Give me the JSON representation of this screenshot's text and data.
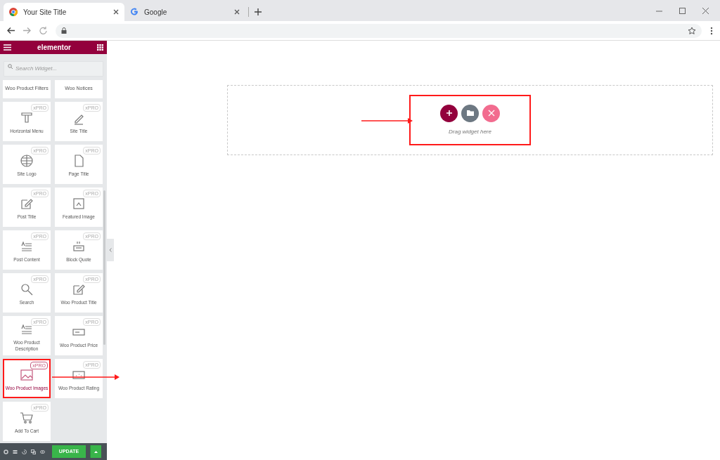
{
  "browser": {
    "tabs": [
      {
        "title": "Your Site Title",
        "selected": true
      },
      {
        "title": "Google",
        "selected": false
      }
    ]
  },
  "editor": {
    "brand": "elementor",
    "search": {
      "placeholder": "Search Widget..."
    },
    "widgets": [
      {
        "kind": "compact",
        "label": "Woo Product Filters",
        "selected": false
      },
      {
        "kind": "compact",
        "label": "Woo Notices",
        "selected": false
      },
      {
        "kind": "tile",
        "label": "Horizontal Menu",
        "badge": "xPRO",
        "selected": false
      },
      {
        "kind": "tile",
        "label": "Site Title",
        "badge": "xPRO",
        "selected": false
      },
      {
        "kind": "tile",
        "label": "Site Logo",
        "badge": "xPRO",
        "selected": false
      },
      {
        "kind": "tile",
        "label": "Page Title",
        "badge": "xPRO",
        "selected": false
      },
      {
        "kind": "tile",
        "label": "Post Title",
        "badge": "xPRO",
        "selected": false
      },
      {
        "kind": "tile",
        "label": "Featured Image",
        "badge": "xPRO",
        "selected": false
      },
      {
        "kind": "tile",
        "label": "Post Content",
        "badge": "xPRO",
        "selected": false
      },
      {
        "kind": "tile",
        "label": "Block Quote",
        "badge": "xPRO",
        "selected": false
      },
      {
        "kind": "tile",
        "label": "Search",
        "badge": "xPRO",
        "selected": false
      },
      {
        "kind": "tile",
        "label": "Woo Product Title",
        "badge": "xPRO",
        "selected": false
      },
      {
        "kind": "tile",
        "label": "Woo Product Description",
        "badge": "xPRO",
        "selected": false
      },
      {
        "kind": "tile",
        "label": "Woo Product Price",
        "badge": "xPRO",
        "selected": false
      },
      {
        "kind": "tile",
        "label": "Woo Product Images",
        "badge": "xPRO",
        "selected": true
      },
      {
        "kind": "tile",
        "label": "Woo Product Rating",
        "badge": "xPRO",
        "selected": false
      },
      {
        "kind": "tile",
        "label": "Add To Cart",
        "badge": "xPRO",
        "selected": false
      }
    ],
    "update_button": "UPDATE"
  },
  "canvas": {
    "drop_hint": "Drag widget here"
  }
}
